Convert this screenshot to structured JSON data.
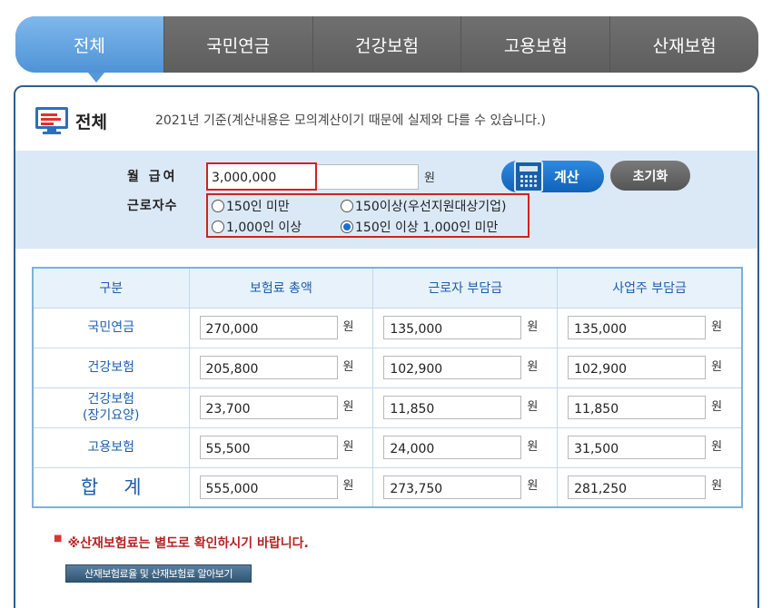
{
  "tabs": [
    {
      "label": "전체",
      "active": true
    },
    {
      "label": "국민연금",
      "active": false
    },
    {
      "label": "건강보험",
      "active": false
    },
    {
      "label": "고용보험",
      "active": false
    },
    {
      "label": "산재보험",
      "active": false
    }
  ],
  "header": {
    "icon": "monitor-icon",
    "title": "전체",
    "note": "2021년 기준(계산내용은 모의계산이기 때문에 실제와 다를 수 있습니다.)"
  },
  "form": {
    "wage_label": "월 급여",
    "wage_value": "3,000,000",
    "wage_unit": "원",
    "workers_label": "근로자수",
    "options": [
      {
        "label": "150인 미만",
        "selected": false
      },
      {
        "label": "150이상(우선지원대상기업)",
        "selected": false
      },
      {
        "label": "1,000인 이상",
        "selected": false
      },
      {
        "label": "150인 이상 1,000인 미만",
        "selected": true
      }
    ],
    "calc_label": "계산",
    "reset_label": "초기화"
  },
  "table": {
    "headers": [
      "구분",
      "보험료 총액",
      "근로자 부담금",
      "사업주 부담금"
    ],
    "unit": "원",
    "rows": [
      {
        "label": "국민연금",
        "values": [
          "270,000",
          "135,000",
          "135,000"
        ]
      },
      {
        "label": "건강보험",
        "values": [
          "205,800",
          "102,900",
          "102,900"
        ]
      },
      {
        "label": "건강보험\n(장기요양)",
        "values": [
          "23,700",
          "11,850",
          "11,850"
        ]
      },
      {
        "label": "고용보험",
        "values": [
          "55,500",
          "24,000",
          "31,500"
        ]
      },
      {
        "label": "합계",
        "values": [
          "555,000",
          "273,750",
          "281,250"
        ]
      }
    ]
  },
  "notice": "※산재보험료는 별도로 확인하시기 바랍니다.",
  "link_button": "산재보험료율 및 산재보험료 알아보기",
  "colors": {
    "accent": "#4f93d6",
    "highlight": "#d32020",
    "table_text": "#1f5ea8"
  }
}
